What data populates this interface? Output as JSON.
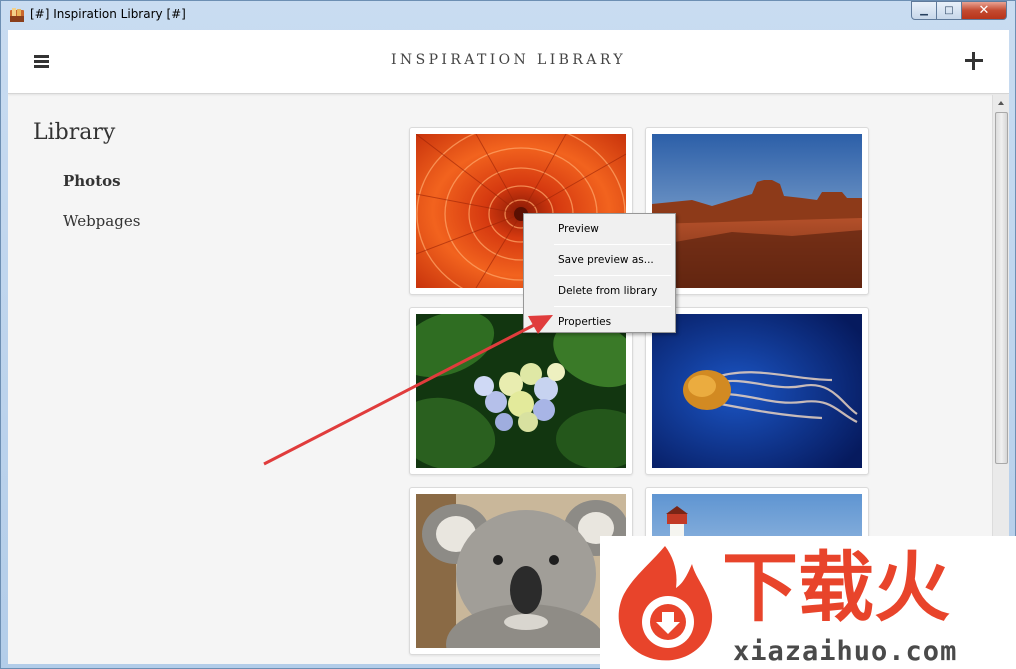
{
  "window": {
    "title": "[#] Inspiration Library [#]",
    "min_glyph": "▁",
    "max_glyph": "□",
    "close_glyph": "✕"
  },
  "header": {
    "title": "INSPIRATION LIBRARY",
    "menu_icon": "hamburger-menu-icon",
    "add_icon": "plus-icon"
  },
  "sidebar": {
    "heading": "Library",
    "items": [
      {
        "label": "Photos",
        "active": true
      },
      {
        "label": "Webpages",
        "active": false
      }
    ]
  },
  "photos": [
    {
      "subject": "orange dahlia flower"
    },
    {
      "subject": "desert butte landscape"
    },
    {
      "subject": "hydrangea flower"
    },
    {
      "subject": "jellyfish"
    },
    {
      "subject": "koala"
    },
    {
      "subject": "lighthouse"
    }
  ],
  "context_menu": {
    "items": [
      "Preview",
      "Save preview as...",
      "Delete from library",
      "Properties"
    ]
  },
  "watermark": {
    "cn_text": "下载火",
    "url": "xiazaihuo.com",
    "brand_color": "#e8442b"
  },
  "annotation": {
    "arrow_color": "#e03c3c"
  }
}
